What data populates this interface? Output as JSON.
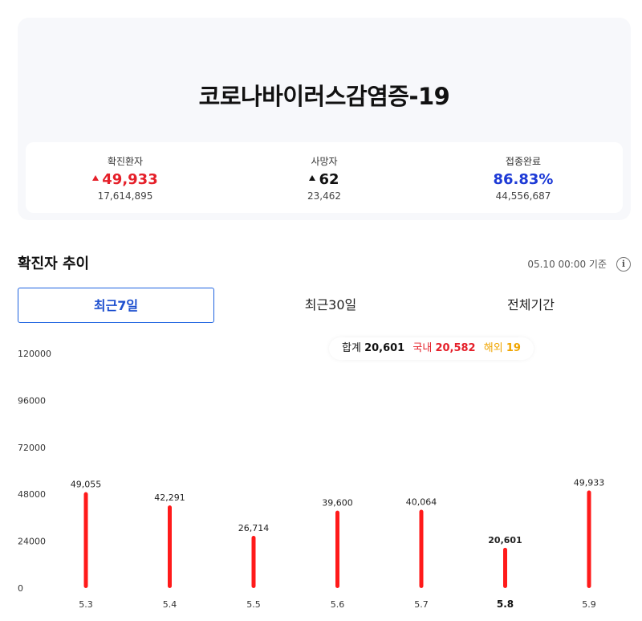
{
  "title": "코로나바이러스감염증-19",
  "stats": [
    {
      "label": "확진환자",
      "main": "49,933",
      "sub": "17,614,895",
      "arrow": true,
      "color": "#e5202a"
    },
    {
      "label": "사망자",
      "main": "62",
      "sub": "23,462",
      "arrow": true,
      "color": "#111111"
    },
    {
      "label": "접종완료",
      "main": "86.83%",
      "sub": "44,556,687",
      "arrow": false,
      "color": "#1d3ad6"
    }
  ],
  "trend": {
    "title": "확진자 추이",
    "base_time": "05.10 00:00 기준",
    "info_icon": "i"
  },
  "tabs": [
    "최근7일",
    "최근30일",
    "전체기간"
  ],
  "summary": {
    "total_label": "합계",
    "total_value": "20,601",
    "domestic_label": "국내",
    "domestic_value": "20,582",
    "overseas_label": "해외",
    "overseas_value": "19"
  },
  "chart_data": {
    "type": "bar",
    "categories": [
      "5.3",
      "5.4",
      "5.5",
      "5.6",
      "5.7",
      "5.8",
      "5.9"
    ],
    "values": [
      49055,
      42291,
      26714,
      39600,
      40064,
      20601,
      49933
    ],
    "value_labels": [
      "49,055",
      "42,291",
      "26,714",
      "39,600",
      "40,064",
      "20,601",
      "49,933"
    ],
    "highlight_index": 5,
    "ylim": [
      0,
      120000
    ],
    "yticks": [
      0,
      24000,
      48000,
      72000,
      96000,
      120000
    ],
    "bar_color": "#ff1a1a",
    "title": "",
    "xlabel": "",
    "ylabel": ""
  }
}
